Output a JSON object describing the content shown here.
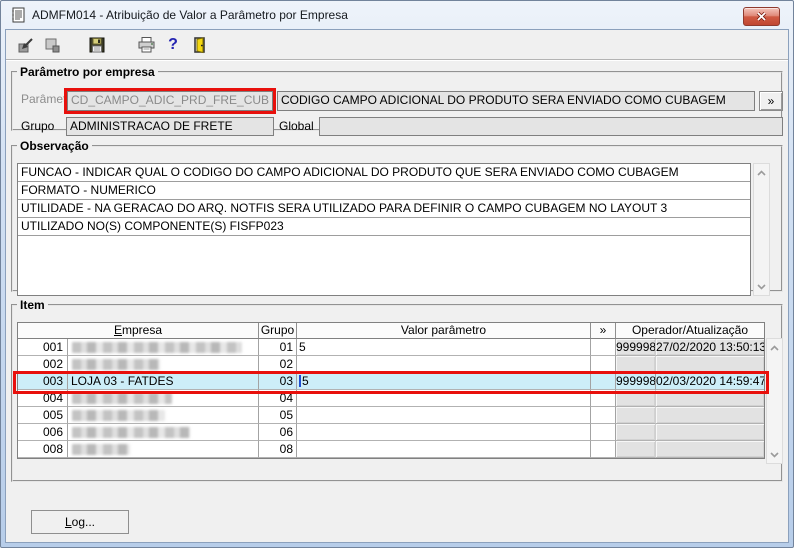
{
  "window": {
    "title": "ADMFM014 - Atribuição de Valor a Parâmetro por Empresa"
  },
  "toolbar": {
    "icons": [
      "shortcut-arrow",
      "cascade-windows",
      "save",
      "print",
      "help",
      "exit-door"
    ],
    "help_glyph": "?"
  },
  "param_group": {
    "title": "Parâmetro por empresa",
    "param_label": "Parâmetro",
    "param_value": "CD_CAMPO_ADIC_PRD_FRE_CUB",
    "param_desc": "CODIGO CAMPO ADICIONAL DO PRODUTO SERA ENVIADO COMO CUBAGEM",
    "expand_button": "»",
    "grupo_label": "Grupo",
    "grupo_value": "ADMINISTRACAO DE FRETE",
    "global_label": "Global",
    "global_value": ""
  },
  "obs_group": {
    "title": "Observação",
    "lines": [
      "FUNCAO - INDICAR QUAL O CODIGO DO CAMPO ADICIONAL DO PRODUTO QUE SERA ENVIADO COMO CUBAGEM",
      "FORMATO - NUMERICO",
      "UTILIDADE - NA GERACAO DO ARQ. NOTFIS SERA UTILIZADO PARA DEFINIR O CAMPO CUBAGEM NO LAYOUT 3",
      "UTILIZADO NO(S) COMPONENTE(S) FISFP023"
    ]
  },
  "item_group": {
    "title": "Item",
    "columns": {
      "empresa": "Empresa",
      "grupo": "Grupo",
      "valor": "Valor parâmetro",
      "expand": "»",
      "operador": "Operador/Atualização"
    },
    "rows": [
      {
        "num": "001",
        "empresa": "",
        "redacted": true,
        "redact_w": 170,
        "grupo": "01",
        "valor": "5",
        "operador": "999998",
        "atualizacao": "27/02/2020 13:50:13",
        "highlight": false
      },
      {
        "num": "002",
        "empresa": "",
        "redacted": true,
        "redact_w": 88,
        "grupo": "02",
        "valor": "",
        "operador": "",
        "atualizacao": "",
        "highlight": false
      },
      {
        "num": "003",
        "empresa": "LOJA 03 - FATDES",
        "redacted": false,
        "redact_w": 0,
        "grupo": "03",
        "valor": "5",
        "operador": "999998",
        "atualizacao": "02/03/2020 14:59:47",
        "highlight": true
      },
      {
        "num": "004",
        "empresa": "",
        "redacted": true,
        "redact_w": 100,
        "grupo": "04",
        "valor": "",
        "operador": "",
        "atualizacao": "",
        "highlight": false
      },
      {
        "num": "005",
        "empresa": "",
        "redacted": true,
        "redact_w": 93,
        "grupo": "05",
        "valor": "",
        "operador": "",
        "atualizacao": "",
        "highlight": false
      },
      {
        "num": "006",
        "empresa": "",
        "redacted": true,
        "redact_w": 118,
        "grupo": "06",
        "valor": "",
        "operador": "",
        "atualizacao": "",
        "highlight": false
      },
      {
        "num": "008",
        "empresa": "",
        "redacted": true,
        "redact_w": 58,
        "grupo": "08",
        "valor": "",
        "operador": "",
        "atualizacao": "",
        "highlight": false
      }
    ]
  },
  "footer": {
    "log_button": "Log..."
  },
  "colors": {
    "annotation_red": "#e8100c",
    "highlight_row": "#cdeef8",
    "titlebar_blue": "#b7cde9"
  }
}
